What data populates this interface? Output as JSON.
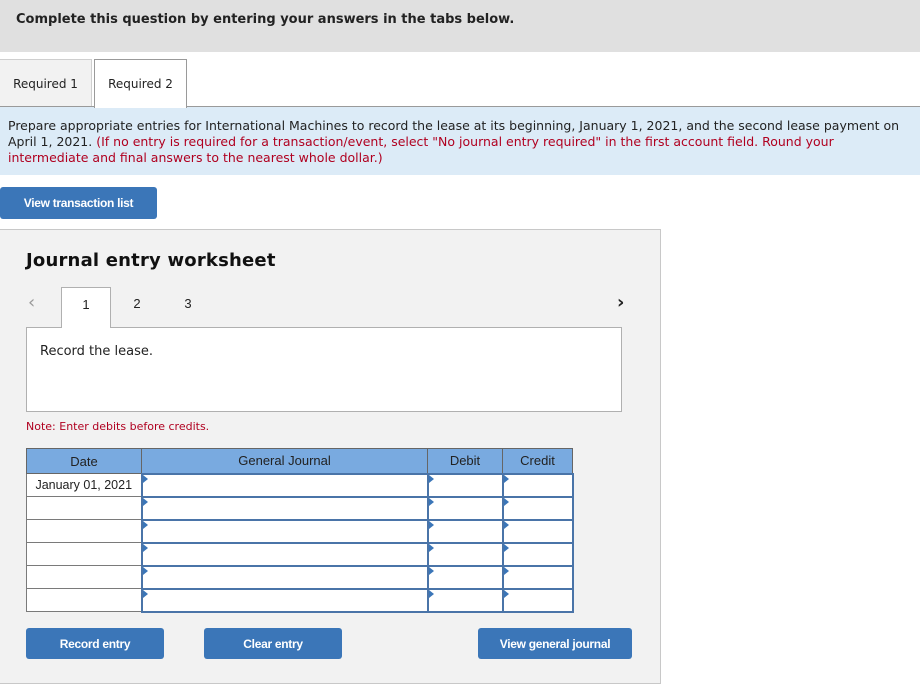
{
  "header": {
    "title": "Complete this question by entering your answers in the tabs below."
  },
  "tabs": [
    {
      "label": "Required 1",
      "active": false
    },
    {
      "label": "Required 2",
      "active": true
    }
  ],
  "instructions": {
    "main": "Prepare appropriate entries for International Machines to record the lease at its beginning, January 1, 2021, and the second lease payment on April 1, 2021.",
    "note": "(If no entry is required for a transaction/event, select \"No journal entry required\" in the first account field. Round your intermediate and final answers to the nearest whole dollar.)"
  },
  "buttons": {
    "view_transaction_list": "View transaction list",
    "record_entry": "Record entry",
    "clear_entry": "Clear entry",
    "view_general_journal": "View general journal"
  },
  "worksheet": {
    "title": "Journal entry worksheet",
    "prev_icon": "‹",
    "next_icon": "›",
    "pages": [
      "1",
      "2",
      "3"
    ],
    "active_page": "1",
    "description": "Record the lease.",
    "note": "Note: Enter debits before credits."
  },
  "journal": {
    "columns": [
      "Date",
      "General Journal",
      "Debit",
      "Credit"
    ],
    "rows": [
      {
        "date": "January 01, 2021",
        "account": "",
        "debit": "",
        "credit": ""
      },
      {
        "date": "",
        "account": "",
        "debit": "",
        "credit": ""
      },
      {
        "date": "",
        "account": "",
        "debit": "",
        "credit": ""
      },
      {
        "date": "",
        "account": "",
        "debit": "",
        "credit": ""
      },
      {
        "date": "",
        "account": "",
        "debit": "",
        "credit": ""
      },
      {
        "date": "",
        "account": "",
        "debit": "",
        "credit": ""
      }
    ]
  },
  "colors": {
    "button_blue": "#3b76b8",
    "header_blue": "#79aae0",
    "instruction_bg": "#dcebf7",
    "note_red": "#b00020"
  }
}
